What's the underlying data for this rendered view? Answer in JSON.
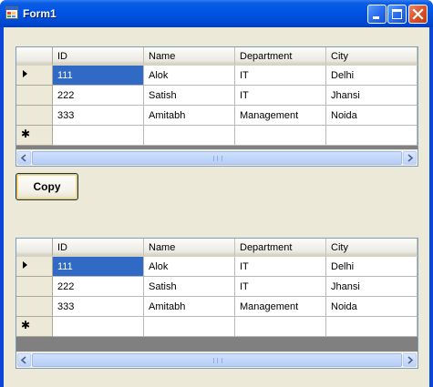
{
  "window": {
    "title": "Form1",
    "icons": {
      "app": "form-app-icon",
      "minimize": "minimize-icon",
      "maximize": "maximize-icon",
      "close": "close-icon"
    }
  },
  "colors": {
    "titlebar": "#0054e3",
    "client": "#ece9d8",
    "selection": "#316ac5",
    "close_button": "#d9542b"
  },
  "grid_top": {
    "columns": [
      "ID",
      "Name",
      "Department",
      "City"
    ],
    "rows": [
      [
        "111",
        "Alok",
        "IT",
        "Delhi"
      ],
      [
        "222",
        "Satish",
        "IT",
        "Jhansi"
      ],
      [
        "333",
        "Amitabh",
        "Management",
        "Noida"
      ]
    ],
    "current_row_indicator": "▶",
    "new_row_indicator": "✱"
  },
  "copy_button": {
    "label": "Copy"
  },
  "grid_bottom": {
    "columns": [
      "ID",
      "Name",
      "Department",
      "City"
    ],
    "rows": [
      [
        "111",
        "Alok",
        "IT",
        "Delhi"
      ],
      [
        "222",
        "Satish",
        "IT",
        "Jhansi"
      ],
      [
        "333",
        "Amitabh",
        "Management",
        "Noida"
      ]
    ],
    "current_row_indicator": "▶",
    "new_row_indicator": "✱"
  }
}
